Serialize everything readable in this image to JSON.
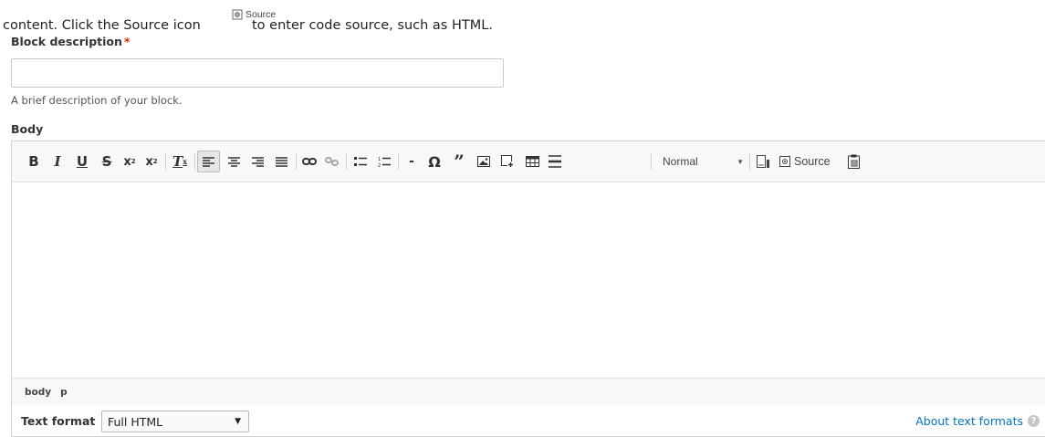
{
  "intro": {
    "before": "content. Click the Source icon",
    "source_label": "Source",
    "after": "to enter code source, such as HTML."
  },
  "block_description": {
    "label": "Block description",
    "required_marker": "*",
    "value": "",
    "help": "A brief description of your block."
  },
  "body": {
    "label": "Body",
    "toolbar": {
      "format_value": "Normal",
      "source_label": "Source"
    },
    "path": [
      "body",
      "p"
    ]
  },
  "text_format": {
    "label": "Text format",
    "selected": "Full HTML",
    "about_link": "About text formats",
    "help_icon": "?"
  },
  "colors": {
    "required": "#e62600",
    "link": "#0074bd"
  }
}
